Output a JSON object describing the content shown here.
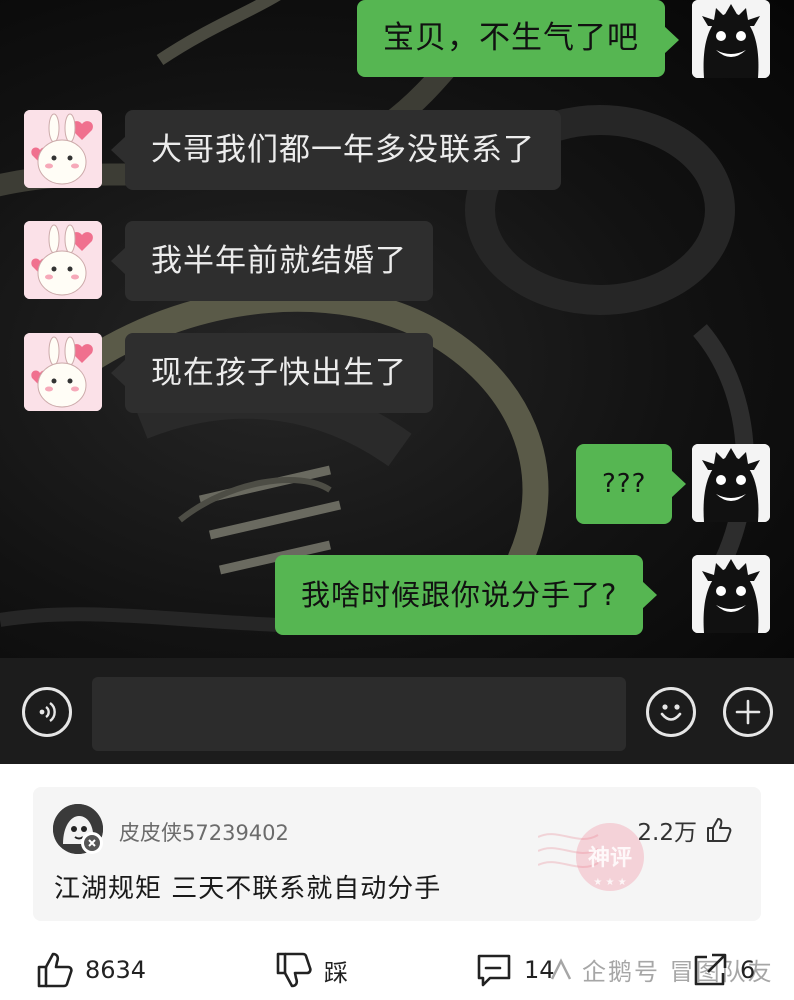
{
  "chat": {
    "messages": [
      {
        "side": "right",
        "text": "宝贝，不生气了吧"
      },
      {
        "side": "left",
        "text": "大哥我们都一年多没联系了"
      },
      {
        "side": "left",
        "text": "我半年前就结婚了"
      },
      {
        "side": "left",
        "text": "现在孩子快出生了"
      },
      {
        "side": "right",
        "text": "???"
      },
      {
        "side": "right",
        "text": "我啥时候跟你说分手了?"
      }
    ],
    "colors": {
      "sent_bubble": "#56b652",
      "received_bubble": "#2e2e2e",
      "background": "#121212"
    },
    "sender_avatar_icon": "shadow-face-icon",
    "receiver_avatar_icon": "bunny-icon"
  },
  "input_bar": {
    "voice_icon": "voice-icon",
    "emoji_icon": "emoji-icon",
    "add_icon": "plus-icon",
    "message_value": ""
  },
  "comment": {
    "user": "皮皮侠57239402",
    "text": "江湖规矩 三天不联系就自动分手",
    "likes": "2.2万",
    "badge": "神评",
    "like_icon": "thumbs-up-icon"
  },
  "actions": {
    "like_count": "8634",
    "dislike_label": "踩",
    "comment_count": "14",
    "share_count": "6"
  },
  "watermark": {
    "text": "企鹅号 冒图队友"
  }
}
